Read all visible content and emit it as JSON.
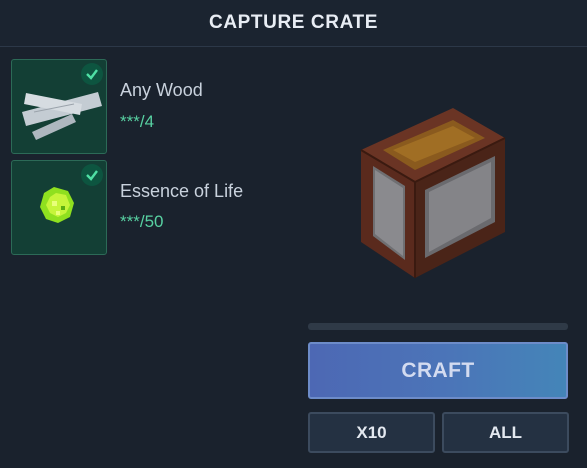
{
  "header": {
    "title": "CAPTURE CRATE"
  },
  "requirements": [
    {
      "name": "Any Wood",
      "count": "***/4",
      "icon": "wood-planks-icon",
      "satisfied": true
    },
    {
      "name": "Essence of Life",
      "count": "***/50",
      "icon": "essence-of-life-icon",
      "satisfied": true
    }
  ],
  "result": {
    "icon": "capture-crate-icon"
  },
  "craft": {
    "progress": 0,
    "craft_label": "CRAFT",
    "x10_label": "X10",
    "all_label": "ALL"
  },
  "colors": {
    "background": "#1a222d",
    "requirement_bg": "#133f35",
    "check": "#4fe0a5",
    "count_text": "#58d1a2",
    "craft_button": "#4d6fb6"
  }
}
